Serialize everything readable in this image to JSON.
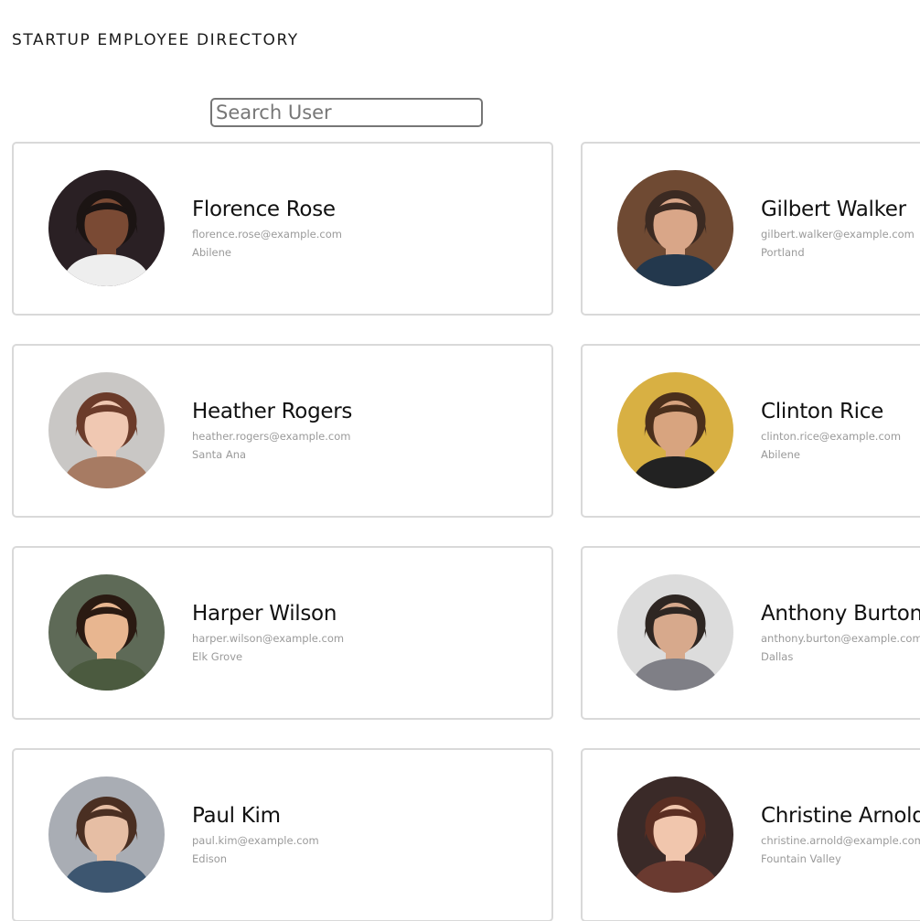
{
  "header": {
    "title": "STARTUP EMPLOYEE DIRECTORY"
  },
  "search": {
    "placeholder": "Search User",
    "value": ""
  },
  "employees": [
    {
      "name": "Florence Rose",
      "email": "florence.rose@example.com",
      "city": "Abilene",
      "bg": "#2a2024",
      "skin": "#7a4a34",
      "hair": "#1b1413",
      "shirt": "#eeeeee"
    },
    {
      "name": "Gilbert Walker",
      "email": "gilbert.walker@example.com",
      "city": "Portland",
      "bg": "#6f4a33",
      "skin": "#d9a688",
      "hair": "#3b2a22",
      "shirt": "#23384d"
    },
    {
      "name": "Heather Rogers",
      "email": "heather.rogers@example.com",
      "city": "Santa Ana",
      "bg": "#c9c7c5",
      "skin": "#f0c8b2",
      "hair": "#6b3b2a",
      "shirt": "#a77b63"
    },
    {
      "name": "Clinton Rice",
      "email": "clinton.rice@example.com",
      "city": "Abilene",
      "bg": "#d8b043",
      "skin": "#d8a47f",
      "hair": "#4a2f1c",
      "shirt": "#222222"
    },
    {
      "name": "Harper Wilson",
      "email": "harper.wilson@example.com",
      "city": "Elk Grove",
      "bg": "#5e6a57",
      "skin": "#e8b690",
      "hair": "#2a1a12",
      "shirt": "#4b5a3f"
    },
    {
      "name": "Anthony Burton",
      "email": "anthony.burton@example.com",
      "city": "Dallas",
      "bg": "#dcdcdc",
      "skin": "#d7a98c",
      "hair": "#2e2622",
      "shirt": "#7f7f86"
    },
    {
      "name": "Paul Kim",
      "email": "paul.kim@example.com",
      "city": "Edison",
      "bg": "#a9adb4",
      "skin": "#e6bea4",
      "hair": "#4a2f22",
      "shirt": "#3d5670"
    },
    {
      "name": "Christine Arnold",
      "email": "christine.arnold@example.com",
      "city": "Fountain Valley",
      "bg": "#3a2a28",
      "skin": "#f1c6ad",
      "hair": "#5b2e22",
      "shirt": "#6a3a30"
    }
  ]
}
